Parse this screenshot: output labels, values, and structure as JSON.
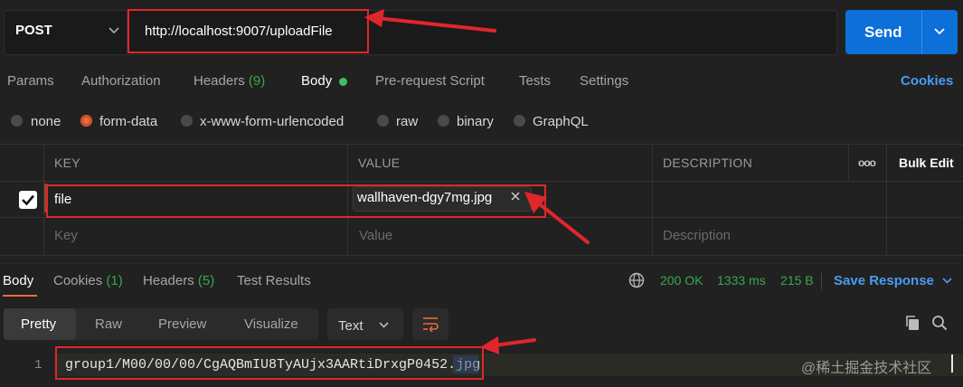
{
  "request": {
    "method": "POST",
    "url": "http://localhost:9007/uploadFile",
    "send_label": "Send"
  },
  "tabs": [
    {
      "label": "Params"
    },
    {
      "label": "Authorization"
    },
    {
      "label": "Headers",
      "count": "(9)"
    },
    {
      "label": "Body"
    },
    {
      "label": "Pre-request Script"
    },
    {
      "label": "Tests"
    },
    {
      "label": "Settings"
    }
  ],
  "cookies_label": "Cookies",
  "body_modes": [
    "none",
    "form-data",
    "x-www-form-urlencoded",
    "raw",
    "binary",
    "GraphQL"
  ],
  "selected_mode": "form-data",
  "table": {
    "headers": [
      "KEY",
      "VALUE",
      "DESCRIPTION"
    ],
    "bulk_edit": "Bulk Edit",
    "more": "ooo",
    "row": {
      "key": "file",
      "value": "wallhaven-dgy7mg.jpg",
      "checked": true
    },
    "placeholders": {
      "key": "Key",
      "value": "Value",
      "description": "Description"
    }
  },
  "response": {
    "tabs": [
      {
        "label": "Body"
      },
      {
        "label": "Cookies",
        "count": "(1)"
      },
      {
        "label": "Headers",
        "count": "(5)"
      },
      {
        "label": "Test Results"
      }
    ],
    "status": "200 OK",
    "time": "1333 ms",
    "size": "215 B",
    "save_label": "Save Response",
    "views": [
      "Pretty",
      "Raw",
      "Preview",
      "Visualize"
    ],
    "format": "Text",
    "line_number": "1",
    "code": "group1/M00/00/00/CgAQBmIU8TyAUjx3AARtiDrxgP0452.jpg"
  },
  "watermark": "@稀土掘金技术社区",
  "colors": {
    "accent": "#f06b3c",
    "send": "#0d6fd8",
    "link": "#4a9cf0",
    "ok": "#37a84f",
    "annotation": "#e0262b"
  }
}
